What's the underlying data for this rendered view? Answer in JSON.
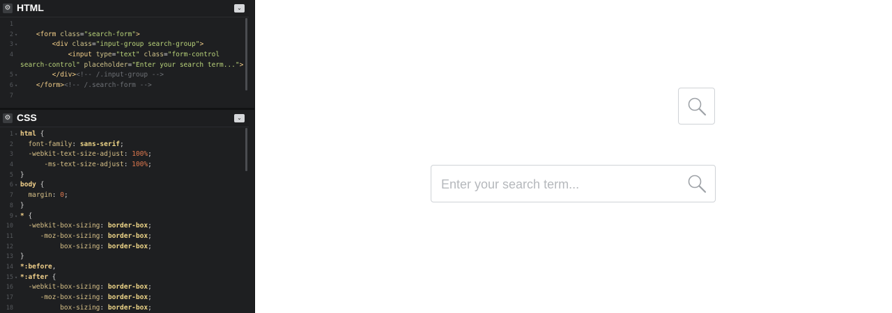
{
  "editor": {
    "html_pane": {
      "title": "HTML",
      "gear_icon": "gear-icon",
      "collapse_icon": "chevron-down-icon",
      "line_numbers": [
        "1",
        "2",
        "3",
        "4",
        "5",
        "6",
        "7"
      ]
    },
    "css_pane": {
      "title": "CSS",
      "gear_icon": "gear-icon",
      "collapse_icon": "chevron-down-icon",
      "line_numbers": [
        "1",
        "2",
        "3",
        "4",
        "5",
        "6",
        "7",
        "8",
        "9",
        "10",
        "11",
        "12",
        "13",
        "14",
        "15",
        "16",
        "17",
        "18"
      ]
    }
  },
  "preview": {
    "search_placeholder": "Enter your search term...",
    "search_icon": "search-icon"
  },
  "colors": {
    "editor_bg": "#1e1f21",
    "border": "#cfd2d6",
    "placeholder": "#b5b8bc"
  }
}
